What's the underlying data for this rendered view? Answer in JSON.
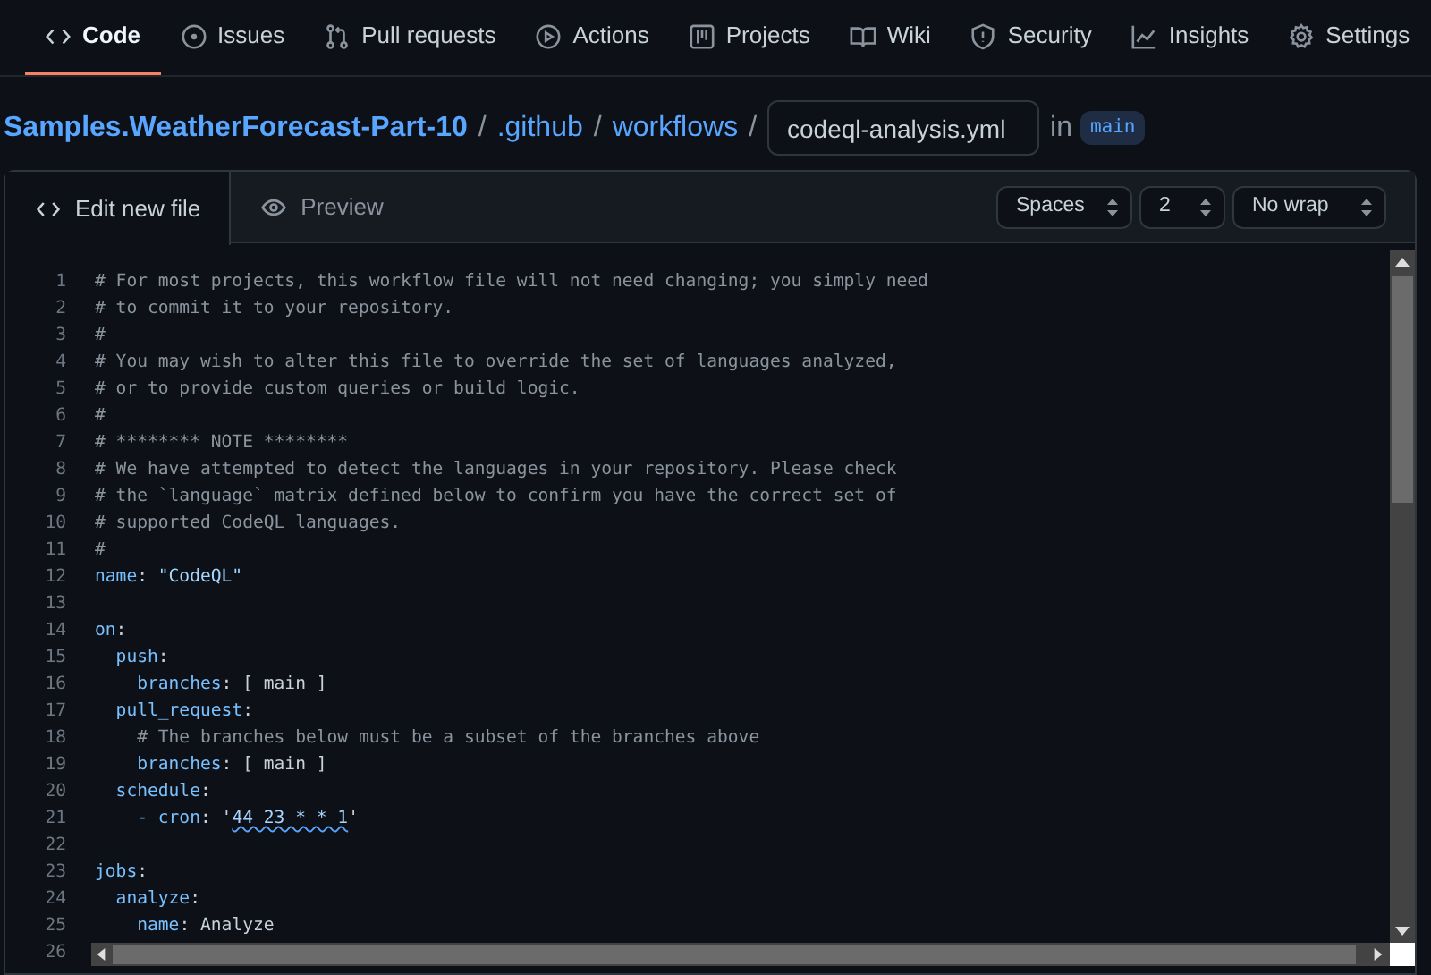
{
  "repo_tabs": [
    {
      "label": "Code",
      "selected": true
    },
    {
      "label": "Issues",
      "selected": false
    },
    {
      "label": "Pull requests",
      "selected": false
    },
    {
      "label": "Actions",
      "selected": false
    },
    {
      "label": "Projects",
      "selected": false
    },
    {
      "label": "Wiki",
      "selected": false
    },
    {
      "label": "Security",
      "selected": false
    },
    {
      "label": "Insights",
      "selected": false
    },
    {
      "label": "Settings",
      "selected": false
    }
  ],
  "breadcrumb": {
    "links": [
      "Samples.WeatherForecast-Part-10",
      ".github",
      "workflows"
    ],
    "separators": [
      "/",
      "/",
      "/"
    ],
    "file_name": "codeql-analysis.yml",
    "in_label": "in",
    "branch": "main"
  },
  "editor": {
    "tabs": [
      {
        "label": "Edit new file",
        "selected": true
      },
      {
        "label": "Preview",
        "selected": false
      }
    ],
    "selects": [
      "Spaces",
      "2",
      "No wrap"
    ],
    "lines": [
      {
        "number": "1",
        "segments": [
          {
            "kind": "comment",
            "text": "# For most projects, this workflow file will not need changing; you simply need"
          }
        ]
      },
      {
        "number": "2",
        "segments": [
          {
            "kind": "comment",
            "text": "# to commit it to your repository."
          }
        ]
      },
      {
        "number": "3",
        "segments": [
          {
            "kind": "comment",
            "text": "#"
          }
        ]
      },
      {
        "number": "4",
        "segments": [
          {
            "kind": "comment",
            "text": "# You may wish to alter this file to override the set of languages analyzed,"
          }
        ]
      },
      {
        "number": "5",
        "segments": [
          {
            "kind": "comment",
            "text": "# or to provide custom queries or build logic."
          }
        ]
      },
      {
        "number": "6",
        "segments": [
          {
            "kind": "comment",
            "text": "#"
          }
        ]
      },
      {
        "number": "7",
        "segments": [
          {
            "kind": "comment",
            "text": "# ******** NOTE ********"
          }
        ]
      },
      {
        "number": "8",
        "segments": [
          {
            "kind": "comment",
            "text": "# We have attempted to detect the languages in your repository. Please check"
          }
        ]
      },
      {
        "number": "9",
        "segments": [
          {
            "kind": "comment",
            "text": "# the `language` matrix defined below to confirm you have the correct set of"
          }
        ]
      },
      {
        "number": "10",
        "segments": [
          {
            "kind": "comment",
            "text": "# supported CodeQL languages."
          }
        ]
      },
      {
        "number": "11",
        "segments": [
          {
            "kind": "comment",
            "text": "#"
          }
        ]
      },
      {
        "number": "12",
        "segments": [
          {
            "kind": "key",
            "text": "name"
          },
          {
            "kind": "plain",
            "text": ": "
          },
          {
            "kind": "string",
            "text": "\"CodeQL\""
          }
        ]
      },
      {
        "number": "13"
      },
      {
        "number": "14",
        "segments": [
          {
            "kind": "key",
            "text": "on"
          },
          {
            "kind": "plain",
            "text": ":"
          }
        ]
      },
      {
        "number": "15",
        "segments": [
          {
            "kind": "key",
            "text": "  push"
          },
          {
            "kind": "plain",
            "text": ":"
          }
        ]
      },
      {
        "number": "16",
        "segments": [
          {
            "kind": "key",
            "text": "    branches"
          },
          {
            "kind": "plain",
            "text": ": [ main ]"
          }
        ]
      },
      {
        "number": "17",
        "segments": [
          {
            "kind": "key",
            "text": "  pull_request"
          },
          {
            "kind": "plain",
            "text": ":"
          }
        ]
      },
      {
        "number": "18",
        "segments": [
          {
            "kind": "comment",
            "text": "    # The branches below must be a subset of the branches above"
          }
        ]
      },
      {
        "number": "19",
        "segments": [
          {
            "kind": "key",
            "text": "    branches"
          },
          {
            "kind": "plain",
            "text": ": [ main ]"
          }
        ]
      },
      {
        "number": "20",
        "segments": [
          {
            "kind": "key",
            "text": "  schedule"
          },
          {
            "kind": "plain",
            "text": ":"
          }
        ]
      },
      {
        "number": "21",
        "segments": [
          {
            "kind": "key",
            "text": "    - cron"
          },
          {
            "kind": "plain",
            "text": ": '"
          },
          {
            "kind": "flagged",
            "text": "44 23 * * 1"
          },
          {
            "kind": "plain",
            "text": "'"
          }
        ]
      },
      {
        "number": "22"
      },
      {
        "number": "23",
        "segments": [
          {
            "kind": "key",
            "text": "jobs"
          },
          {
            "kind": "plain",
            "text": ":"
          }
        ]
      },
      {
        "number": "24",
        "segments": [
          {
            "kind": "key",
            "text": "  analyze"
          },
          {
            "kind": "plain",
            "text": ":"
          }
        ]
      },
      {
        "number": "25",
        "segments": [
          {
            "kind": "key",
            "text": "    name"
          },
          {
            "kind": "plain",
            "text": ": Analyze"
          }
        ]
      },
      {
        "number": "26"
      }
    ]
  }
}
